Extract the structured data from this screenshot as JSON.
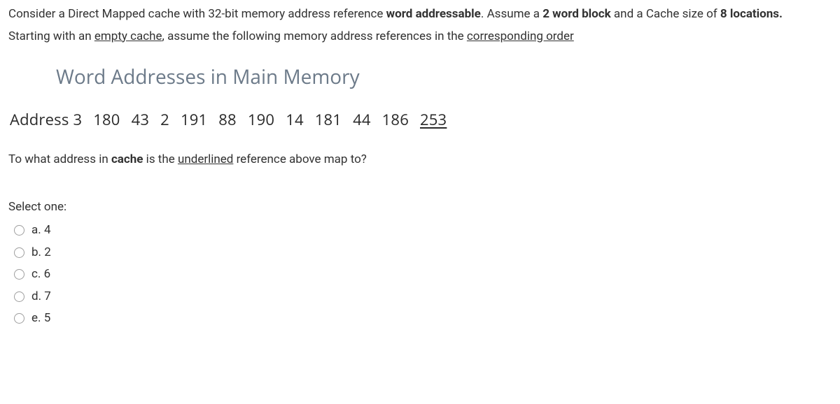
{
  "intro": {
    "part1": "Consider a Direct Mapped cache with 32-bit memory address reference ",
    "bold1": "word addressable",
    "part2": ". Assume a ",
    "bold2": "2 word block",
    "part3": " and a Cache size of ",
    "bold3": "8 locations."
  },
  "starting": {
    "part1": "Starting with an ",
    "u1": "empty cache",
    "part2": ", assume the following memory address references in the ",
    "u2": "corresponding order"
  },
  "heading": "Word Addresses in Main Memory",
  "address_label": "Address",
  "addresses": [
    "3",
    "180",
    "43",
    "2",
    "191",
    "88",
    "190",
    "14",
    "181",
    "44",
    "186",
    "253"
  ],
  "underlined_index": 11,
  "followup": {
    "part1": "To what address in ",
    "bold1": "cache",
    "part2": " is the ",
    "u1": "underlined",
    "part3": " reference above map to?"
  },
  "select_one": "Select one:",
  "options": [
    {
      "id": "a",
      "label": "a. 4"
    },
    {
      "id": "b",
      "label": "b. 2"
    },
    {
      "id": "c",
      "label": "c. 6"
    },
    {
      "id": "d",
      "label": "d. 7"
    },
    {
      "id": "e",
      "label": "e. 5"
    }
  ]
}
